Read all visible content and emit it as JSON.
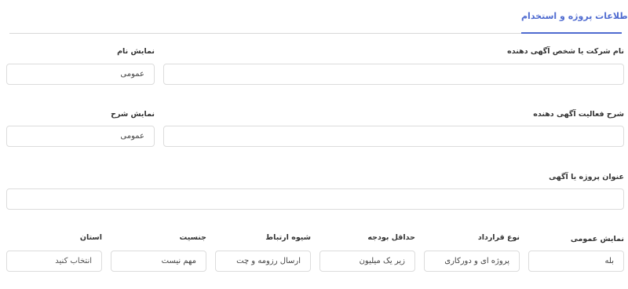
{
  "tab": {
    "label": "اطلاعات پروژه و استخدام",
    "icon": "info-icon"
  },
  "company": {
    "label": "نام شرکت یا شخص آگهی دهنده",
    "value": ""
  },
  "show_name": {
    "label": "نمایش نام",
    "value": "عمومی"
  },
  "activity": {
    "label": "شرح فعالیت آگهی دهنده",
    "value": ""
  },
  "show_description": {
    "label": "نمایش شرح",
    "value": "عمومی"
  },
  "title": {
    "label": "عنوان پروژه یا آگهی",
    "value": ""
  },
  "public_display": {
    "label": "نمایش عمومی",
    "value": "بله"
  },
  "contract_type": {
    "label": "نوع قرارداد",
    "value": "پروژه ای و دورکاری"
  },
  "min_budget": {
    "label": "حداقل بودجه",
    "value": "زیر یک میلیون"
  },
  "contact_method": {
    "label": "شیوه ارتباط",
    "value": "ارسال رزومه و چت"
  },
  "gender": {
    "label": "جنسیت",
    "value": "مهم نیست"
  },
  "province": {
    "label": "استان",
    "placeholder": "انتخاب کنید"
  },
  "colors": {
    "accent": "#4f6bd0",
    "border": "#dcdcdc"
  }
}
